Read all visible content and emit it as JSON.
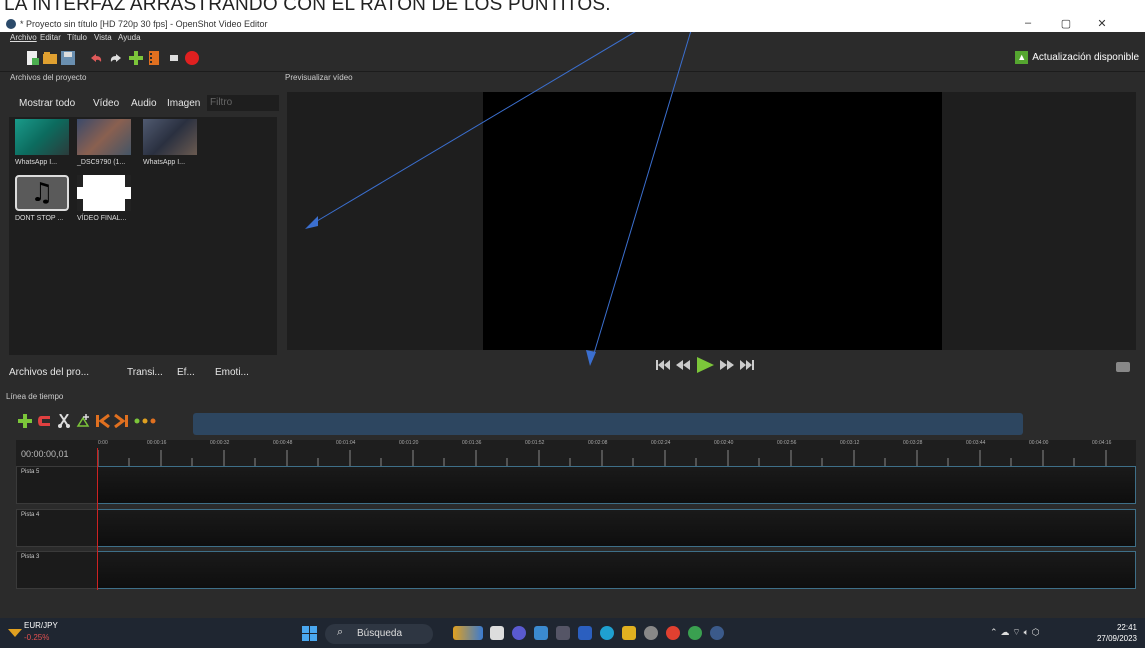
{
  "annotation": {
    "text": "LA INTERFAZ ARRASTRANDO CON EL RATÓN DE LOS PUNTITOS."
  },
  "window": {
    "title": "* Proyecto sin título [HD 720p 30 fps] - OpenShot Video Editor",
    "minimize": "–",
    "maximize": "▢",
    "close": "✕"
  },
  "menu": {
    "items": [
      "Archivo",
      "Editar",
      "Título",
      "Vista",
      "Ayuda"
    ]
  },
  "toolbar": {
    "update_label": "Actualización disponible",
    "update_icon": "up-arrow-icon"
  },
  "panels": {
    "files_title": "Archivos del proyecto",
    "preview_title": "Previsualizar vídeo",
    "timeline_title": "Línea de tiempo"
  },
  "files": {
    "filters": [
      "Mostrar todo",
      "Vídeo",
      "Audio",
      "Imagen"
    ],
    "filter_placeholder": "Filtro",
    "items": [
      {
        "label": "WhatsApp I...",
        "kind": "video"
      },
      {
        "label": "_DSC9790 (1...",
        "kind": "image"
      },
      {
        "label": "WhatsApp I...",
        "kind": "video"
      },
      {
        "label": "DONT STOP ...",
        "kind": "audio"
      },
      {
        "label": "VÍDEO FINAL...",
        "kind": "video"
      }
    ],
    "bottom_tabs": [
      "Archivos del pro...",
      "Transi...",
      "Ef...",
      "Emoti..."
    ]
  },
  "timeline": {
    "timecode": "00:00:00,01",
    "ticks": [
      "0:00",
      "00:00:16",
      "00:00:32",
      "00:00:48",
      "00:01:04",
      "00:01:20",
      "00:01:36",
      "00:01:52",
      "00:02:08",
      "00:02:24",
      "00:02:40",
      "00:02:56",
      "00:03:12",
      "00:03:28",
      "00:03:44",
      "00:04:00",
      "00:04:16"
    ],
    "tracks": [
      "Pista 5",
      "Pista 4",
      "Pista 3"
    ]
  },
  "taskbar": {
    "ticker_symbol": "EUR/JPY",
    "ticker_change": "-0.25%",
    "search_label": "Búsqueda",
    "time": "22:41",
    "date": "27/09/2023"
  },
  "colors": {
    "accent_green": "#55a630",
    "playhead": "#cc2222",
    "scroll": "#2d4660",
    "arrow": "#3b6fcf"
  }
}
